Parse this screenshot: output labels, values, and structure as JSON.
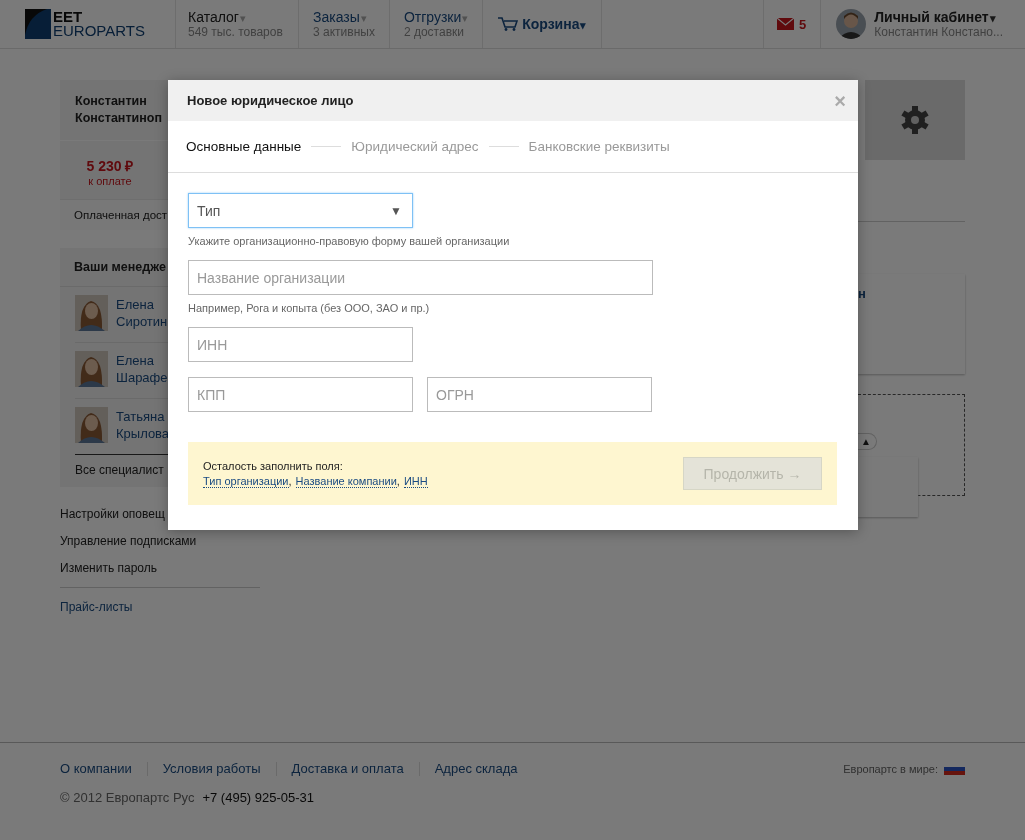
{
  "header": {
    "logo": {
      "line1": "EET",
      "line2": "EUROPARTS"
    },
    "nav": [
      {
        "label": "Каталог",
        "caret": "▾",
        "sub": "549 тыс. товаров",
        "selected": true,
        "kind": "menu"
      },
      {
        "label": "Заказы",
        "caret": "▾",
        "sub": "3 активных",
        "selected": false,
        "kind": "menu"
      },
      {
        "label": "Отгрузки",
        "caret": "▾",
        "sub": "2 доставки",
        "selected": false,
        "kind": "menu"
      },
      {
        "label": "Корзина",
        "caret": "▾",
        "selected": false,
        "kind": "cart"
      }
    ],
    "mail_count": "5",
    "account": {
      "label": "Личный кабинет",
      "caret": "▾",
      "sub": "Константин Констано..."
    }
  },
  "sidebar": {
    "profile": {
      "name_line1": "Константин",
      "name_line2": "Константиноп",
      "amount": "5 230 ₽",
      "amount_label": "к оплате",
      "paid_row": "Оплаченная дост"
    },
    "managers": {
      "title": "Ваши менедже",
      "items": [
        {
          "first": "Елена",
          "last": "Сиротин"
        },
        {
          "first": "Елена",
          "last": "Шарафе"
        },
        {
          "first": "Татьяна",
          "last": "Крылова"
        }
      ],
      "all_link": "Все специалист"
    },
    "links": [
      {
        "label": "Настройки оповещ",
        "kind": "plain"
      },
      {
        "label": "Управление подписками",
        "kind": "plain"
      },
      {
        "label": "Изменить пароль",
        "kind": "plain"
      },
      {
        "label": "Прайс-листы",
        "kind": "link"
      }
    ]
  },
  "right": {
    "card_fragment": "н",
    "toggle": "▲"
  },
  "modal": {
    "title": "Новое юридическое лицо",
    "close": "×",
    "steps": [
      {
        "label": "Основные данные",
        "selected": true
      },
      {
        "label": "Юридический адрес",
        "selected": false
      },
      {
        "label": "Банковские реквизиты",
        "selected": false
      }
    ],
    "type_select": {
      "placeholder": "Тип",
      "caret": "▼",
      "focused": true
    },
    "type_hint": "Укажите организационно-правовую форму вашей организации",
    "name_field": {
      "placeholder": "Название организации"
    },
    "name_hint": "Например, Рога и копыта (без ООО, ЗАО и пр.)",
    "inn_field": {
      "placeholder": "ИНН"
    },
    "kpp_field": {
      "placeholder": "КПП"
    },
    "ogrn_field": {
      "placeholder": "ОГРН"
    },
    "notice": {
      "text": "Осталость заполнить поля:",
      "missing": [
        {
          "label": "Тип организации",
          "separator": ","
        },
        {
          "label": "Название компании",
          "separator": ","
        },
        {
          "label": "ИНН"
        }
      ]
    },
    "continue_button": {
      "label": "Продолжить →",
      "disabled": true
    }
  },
  "footer": {
    "links": [
      "О компании",
      "Условия работы",
      "Доставка и оплата",
      "Адрес склада"
    ],
    "copyright": "© 2012 Европартс Рус",
    "phone": "+7 (495) 925-05-31",
    "world_label": "Европартс в мире:"
  }
}
